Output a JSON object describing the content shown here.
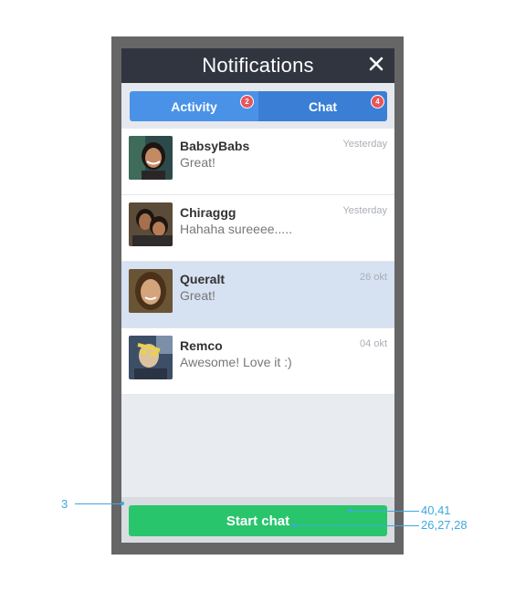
{
  "header": {
    "title": "Notifications",
    "close_icon": "close-icon"
  },
  "tabs": [
    {
      "label": "Activity",
      "badge": "2"
    },
    {
      "label": "Chat",
      "badge": "4"
    }
  ],
  "conversations": [
    {
      "name": "BabsyBabs",
      "message": "Great!",
      "time": "Yesterday",
      "selected": false
    },
    {
      "name": "Chiraggg",
      "message": "Hahaha sureeee.....",
      "time": "Yesterday",
      "selected": false
    },
    {
      "name": "Queralt",
      "message": "Great!",
      "time": "26 okt",
      "selected": true
    },
    {
      "name": "Remco",
      "message": "Awesome! Love it :)",
      "time": "04 okt",
      "selected": false
    }
  ],
  "footer": {
    "start_chat_label": "Start chat"
  },
  "annotations": {
    "left": "3",
    "right_top": "40,41",
    "right_bottom": "26,27,28"
  },
  "colors": {
    "header_bg": "#313540",
    "tab_active": "#4a92e8",
    "badge": "#e9545b",
    "selected_row": "#d6e1f1",
    "start_button": "#29c56c",
    "annotation": "#3ea8df"
  }
}
